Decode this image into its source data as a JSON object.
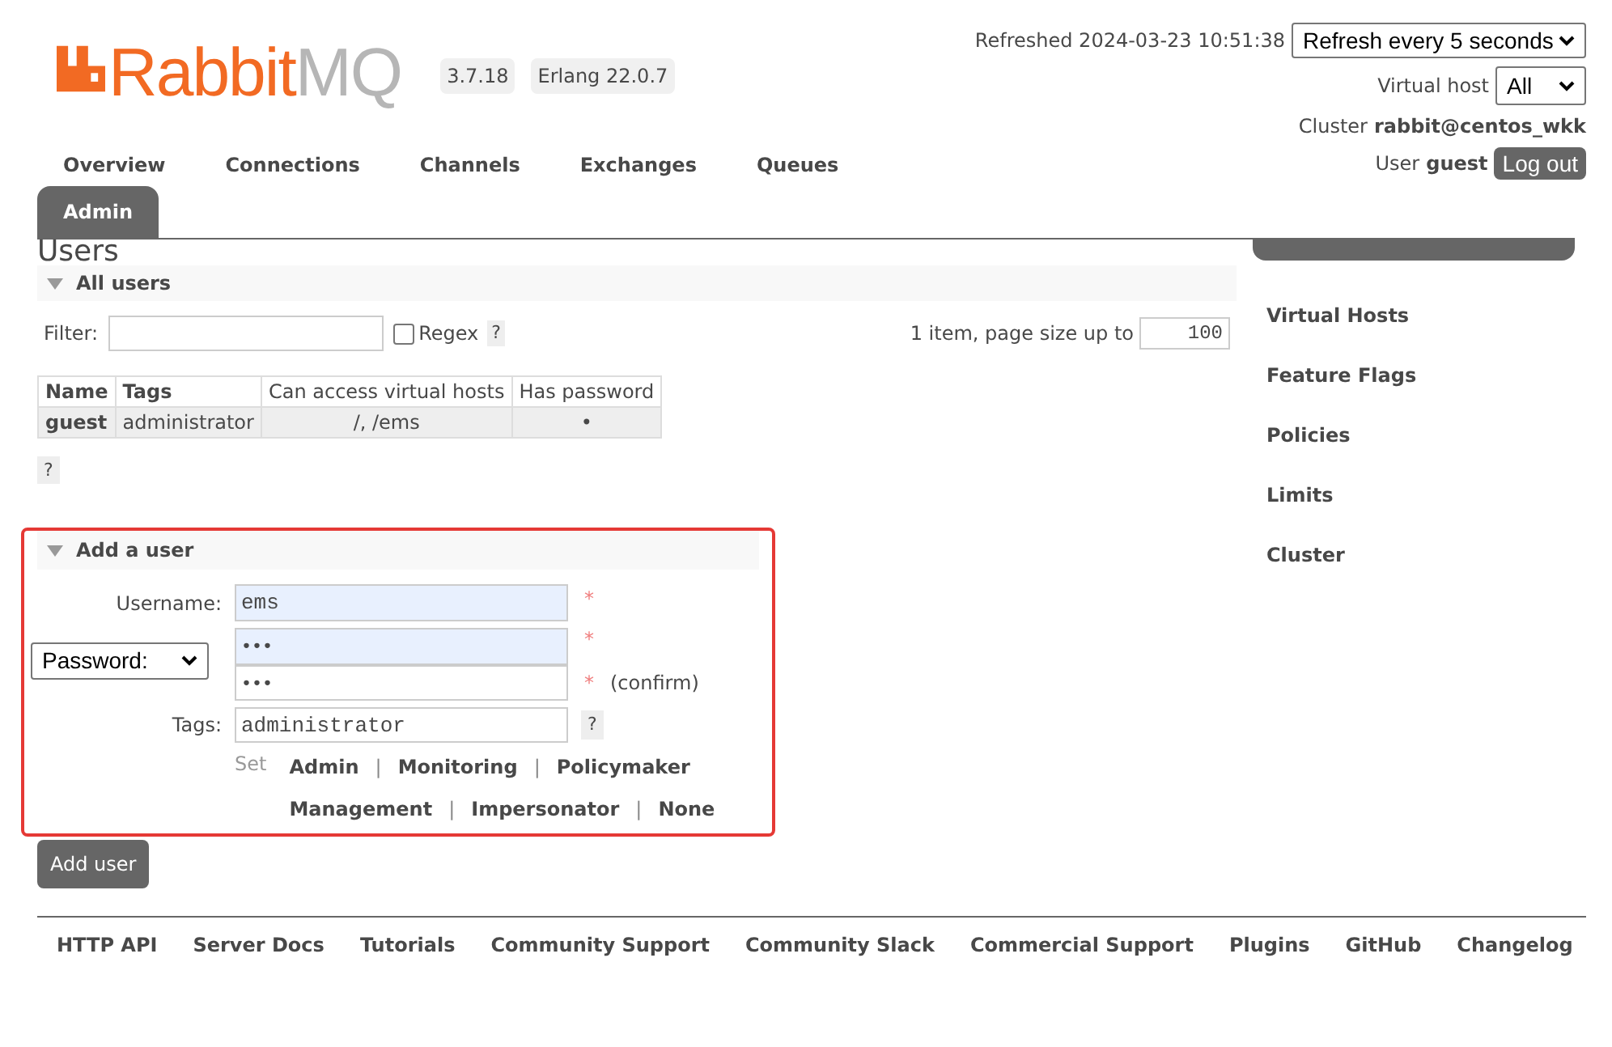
{
  "header": {
    "logo": {
      "text_main": "Rabbit",
      "text_accent": "MQ"
    },
    "badges": [
      "3.7.18",
      "Erlang 22.0.7"
    ],
    "refreshed": "Refreshed 2024-03-23 10:51:38",
    "refresh_select": "Refresh every 5 seconds",
    "vhost_label": "Virtual host",
    "vhost_select": "All",
    "cluster_label": "Cluster",
    "cluster_value": "rabbit@centos_wkk",
    "user_label": "User",
    "user_value": "guest",
    "logout": "Log out"
  },
  "nav": [
    {
      "label": "Overview",
      "selected": false
    },
    {
      "label": "Connections",
      "selected": false
    },
    {
      "label": "Channels",
      "selected": false
    },
    {
      "label": "Exchanges",
      "selected": false
    },
    {
      "label": "Queues",
      "selected": false
    },
    {
      "label": "Admin",
      "selected": true
    }
  ],
  "page_title": "Users",
  "sidebar": [
    {
      "label": "Virtual Hosts",
      "selected": false
    },
    {
      "label": "Feature Flags",
      "selected": false
    },
    {
      "label": "Policies",
      "selected": false
    },
    {
      "label": "Limits",
      "selected": false
    },
    {
      "label": "Cluster",
      "selected": false
    }
  ],
  "all_users": {
    "title": "All users",
    "expanded": true,
    "filter_label": "Filter:",
    "regex_label": "Regex",
    "regex_checked": false,
    "help": "?",
    "paging": "1 item, page size up to",
    "page_size": "100",
    "columns": [
      "Name",
      "Tags",
      "Can access virtual hosts",
      "Has password"
    ],
    "rows": [
      [
        "guest",
        "administrator",
        "/, /ems",
        "•"
      ]
    ],
    "table_help": "?"
  },
  "add_user": {
    "title": "Add a user",
    "expanded": true,
    "highlighted": true,
    "username_label": "Username:",
    "username": "ems",
    "required": "*",
    "password_mode": "Password:",
    "password": "•••",
    "password_confirm": "•••",
    "confirm_note": "(confirm)",
    "tags_label": "Tags:",
    "tags": "administrator",
    "help": "?",
    "set_label": "Set",
    "separator": "|",
    "tag_lines": [
      [
        "Admin",
        "Monitoring",
        "Policymaker"
      ],
      [
        "Management",
        "Impersonator",
        "None"
      ]
    ],
    "submit": "Add user"
  },
  "footer": [
    "HTTP API",
    "Server Docs",
    "Tutorials",
    "Community Support",
    "Community Slack",
    "Commercial Support",
    "Plugins",
    "GitHub",
    "Changelog"
  ]
}
